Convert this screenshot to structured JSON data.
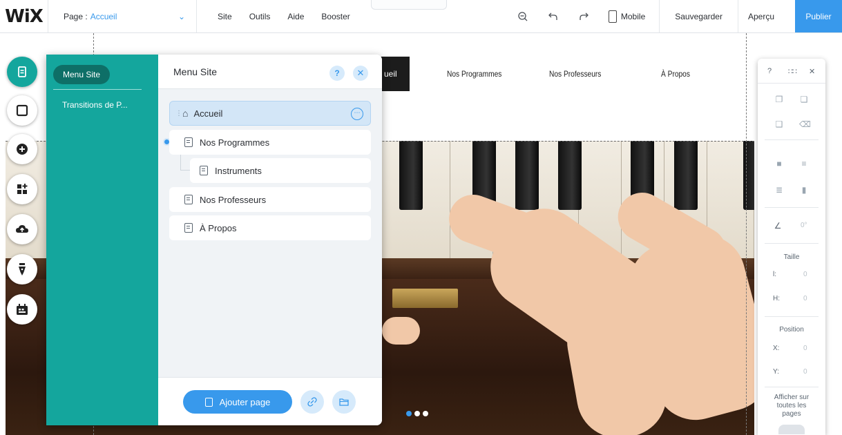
{
  "app": {
    "logo": "WiX"
  },
  "topbar": {
    "page_label": "Page :",
    "page_value": "Accueil",
    "menu": [
      "Site",
      "Outils",
      "Aide",
      "Booster"
    ],
    "mobile_label": "Mobile",
    "save_label": "Sauvegarder",
    "preview_label": "Aperçu",
    "publish_label": "Publier"
  },
  "site": {
    "nav": [
      {
        "label": "ueil",
        "active": true
      },
      {
        "label": "Nos Programmes",
        "active": false
      },
      {
        "label": "Nos Professeurs",
        "active": false
      },
      {
        "label": "À Propos",
        "active": false
      }
    ],
    "slideshow": {
      "slides": 3,
      "current": 1
    }
  },
  "left_toolbar": {
    "buttons": [
      "pages-icon",
      "background-icon",
      "add-icon",
      "apps-icon",
      "upload-icon",
      "blog-icon",
      "bookings-icon"
    ],
    "active": 0
  },
  "pages_panel": {
    "nav_active": "Menu Site",
    "nav_items": [
      "Transitions de P..."
    ],
    "title": "Menu Site",
    "help": "?",
    "close": "✕",
    "pages": [
      {
        "label": "Accueil",
        "home": true,
        "selected": true,
        "level": 0
      },
      {
        "label": "Nos Programmes",
        "home": false,
        "selected": false,
        "level": 0
      },
      {
        "label": "Instruments",
        "home": false,
        "selected": false,
        "level": 1
      },
      {
        "label": "Nos Professeurs",
        "home": false,
        "selected": false,
        "level": 0
      },
      {
        "label": "À Propos",
        "home": false,
        "selected": false,
        "level": 0
      }
    ],
    "add_page_label": "Ajouter page"
  },
  "properties_panel": {
    "help": "?",
    "close": "✕",
    "rotation_value": "0°",
    "size_label": "Taille",
    "width_label": "l:",
    "width_value": "0",
    "height_label": "H:",
    "height_value": "0",
    "position_label": "Position",
    "x_label": "X:",
    "x_value": "0",
    "y_label": "Y:",
    "y_value": "0",
    "show_all_pages_label": "Afficher sur toutes les pages"
  },
  "colors": {
    "accent": "#3899ec",
    "panel_teal": "#14a69d",
    "panel_teal_dark": "#0e6f67",
    "selected_row": "#d3e6f7"
  }
}
